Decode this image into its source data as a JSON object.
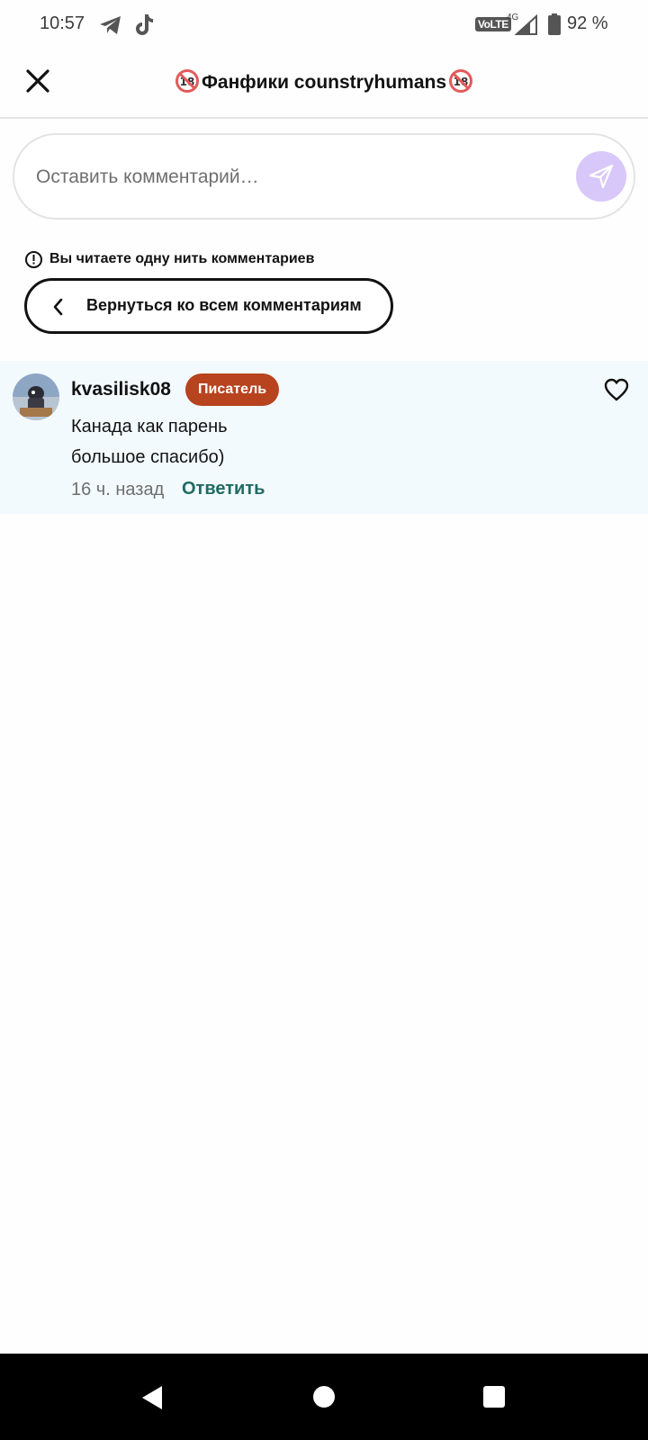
{
  "status_bar": {
    "time": "10:57",
    "network_badge": "VoLTE",
    "network_type": "4G",
    "battery_percent": "92 %",
    "battery_level": 0.92,
    "icons": [
      "telegram-icon",
      "tiktok-icon",
      "signal-icon",
      "battery-icon"
    ]
  },
  "header": {
    "title": "Фанфики counstryhumans",
    "close_icon": "close-icon",
    "badge_icon": "adult-18-icon"
  },
  "comment_input": {
    "placeholder": "Оставить комментарий…",
    "value": "",
    "send_icon": "send-icon"
  },
  "thread": {
    "notice": "Вы читаете одну нить комментариев",
    "back_label": "Вернуться ко всем комментариям"
  },
  "comment": {
    "username": "kvasilisk08",
    "role": "Писатель",
    "text_lines": [
      "Канада как парень",
      "большое спасибо)"
    ],
    "timestamp": "16 ч. назад",
    "reply_label": "Ответить"
  },
  "colors": {
    "accent_badge": "#b7431f",
    "reply_link": "#1f6b63",
    "comment_bg": "#f3fafd",
    "send_button": "#d8c8fa"
  }
}
